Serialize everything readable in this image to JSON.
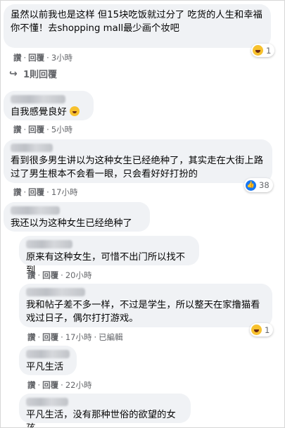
{
  "comments": [
    {
      "text": "虽然以前我也是这样 但15块吃饭就过分了 吃货的人生和幸福你不懂！去shopping mall最少画个妆吧",
      "like": "讚",
      "reply": "回覆",
      "time": "3小時",
      "reaction_count": "1",
      "replies_label": "1則回覆"
    },
    {
      "text": "自我感覺良好",
      "like": "讚",
      "reply": "回覆",
      "time": "5小時"
    },
    {
      "text": "看到很多男生讲以为这种女生已经绝种了，其实走在大街上路过了男生根本不会看一眼，只会看好好打扮的",
      "like": "讚",
      "reply": "回覆",
      "time": "17小時",
      "reaction_count": "38"
    },
    {
      "text": "我还以为这种女生已经绝种了"
    },
    {
      "text": "原来有这种女生，可惜不出门所以找不到",
      "like": "讚",
      "reply": "回覆",
      "time": "20小時"
    },
    {
      "text": "我和帖子差不多一样，不过是学生，所以整天在家撸猫看戏过日子，偶尔打打游戏。",
      "like": "讚",
      "reply": "回覆",
      "time": "17小時",
      "edited": "已編輯",
      "reaction_count": "1"
    },
    {
      "text": "平凡生活",
      "like": "讚",
      "reply": "回覆",
      "time": "22小時"
    },
    {
      "text": "平凡生活，没有那种世俗的欲望的女孩"
    }
  ],
  "separator": "·",
  "colors": {
    "bubble": "#f0f2f5",
    "meta": "#65676b",
    "like_blue": "#1877f2",
    "haha_yellow": "#f7c12e"
  },
  "icons": {
    "reply_arrow": "↪",
    "haha": "haha-emoji-icon",
    "like": "like-thumb-icon"
  }
}
